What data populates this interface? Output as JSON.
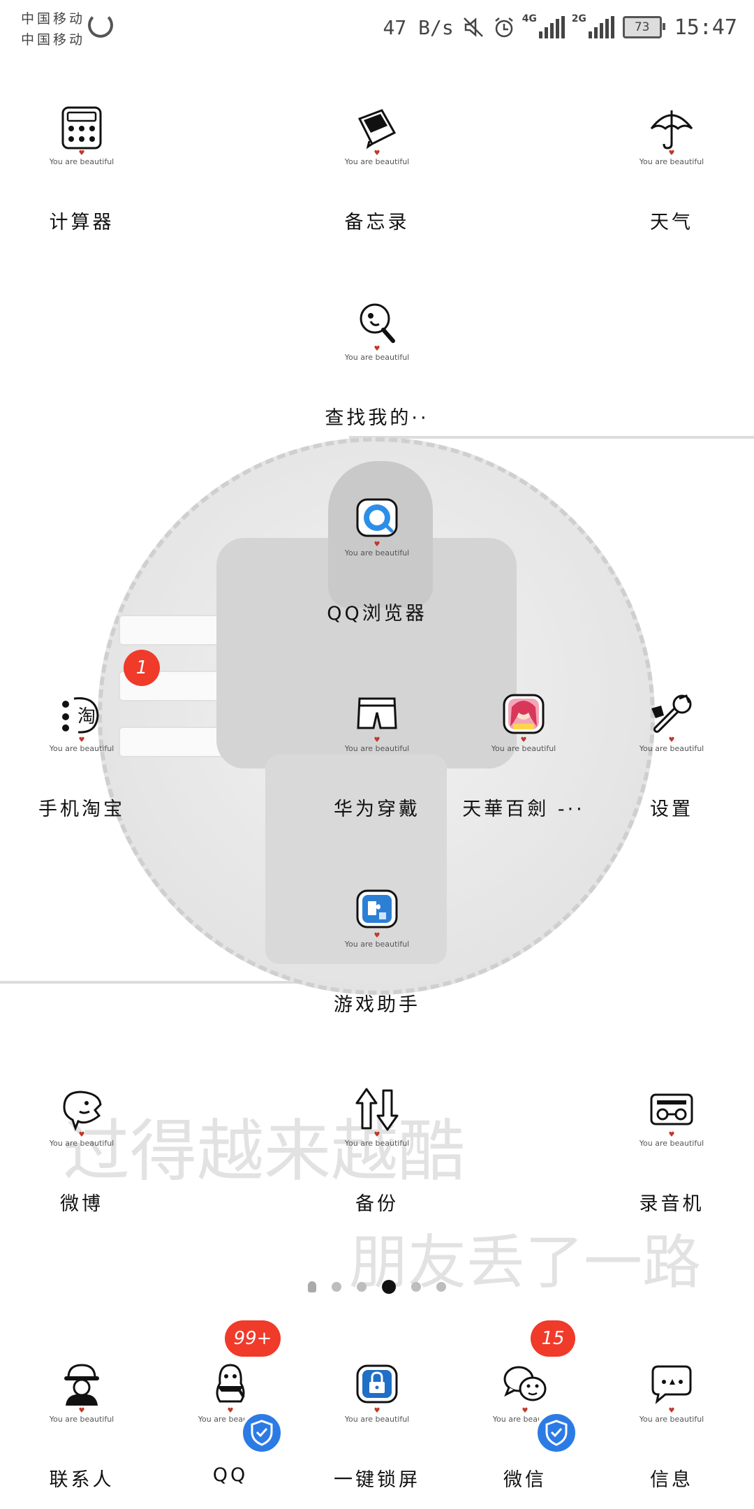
{
  "status_bar": {
    "carrier_1": "中国移动",
    "carrier_2": "中国移动",
    "net_speed": "47 B/s",
    "signal_1_type": "4G",
    "signal_2_type": "2G",
    "battery_level": "73",
    "time": "15:47"
  },
  "icon_tagline": "You are beautiful",
  "apps": {
    "calculator": "计算器",
    "memo": "备忘录",
    "weather": "天气",
    "find_my": "查找我的··",
    "qq_browser": "QQ浏览器",
    "taobao": "手机淘宝",
    "huawei_wear": "华为穿戴",
    "tianhua": "天華百劍 -··",
    "settings": "设置",
    "game_assistant": "游戏助手",
    "weibo": "微博",
    "backup": "备份",
    "recorder": "录音机"
  },
  "badges": {
    "taobao": "1",
    "qq": "99+",
    "wechat": "15"
  },
  "dock": {
    "contacts": "联系人",
    "qq": "QQ",
    "lock_screen": "一键锁屏",
    "wechat": "微信",
    "messages": "信息"
  },
  "wallpaper_text": {
    "line_1": "过得越来越酷",
    "line_2": "朋友丢了一路"
  },
  "page_indicator": {
    "total_pages": 5,
    "current_page": 3
  },
  "colors": {
    "badge": "#f03a2a",
    "shield": "#2c7be5"
  }
}
